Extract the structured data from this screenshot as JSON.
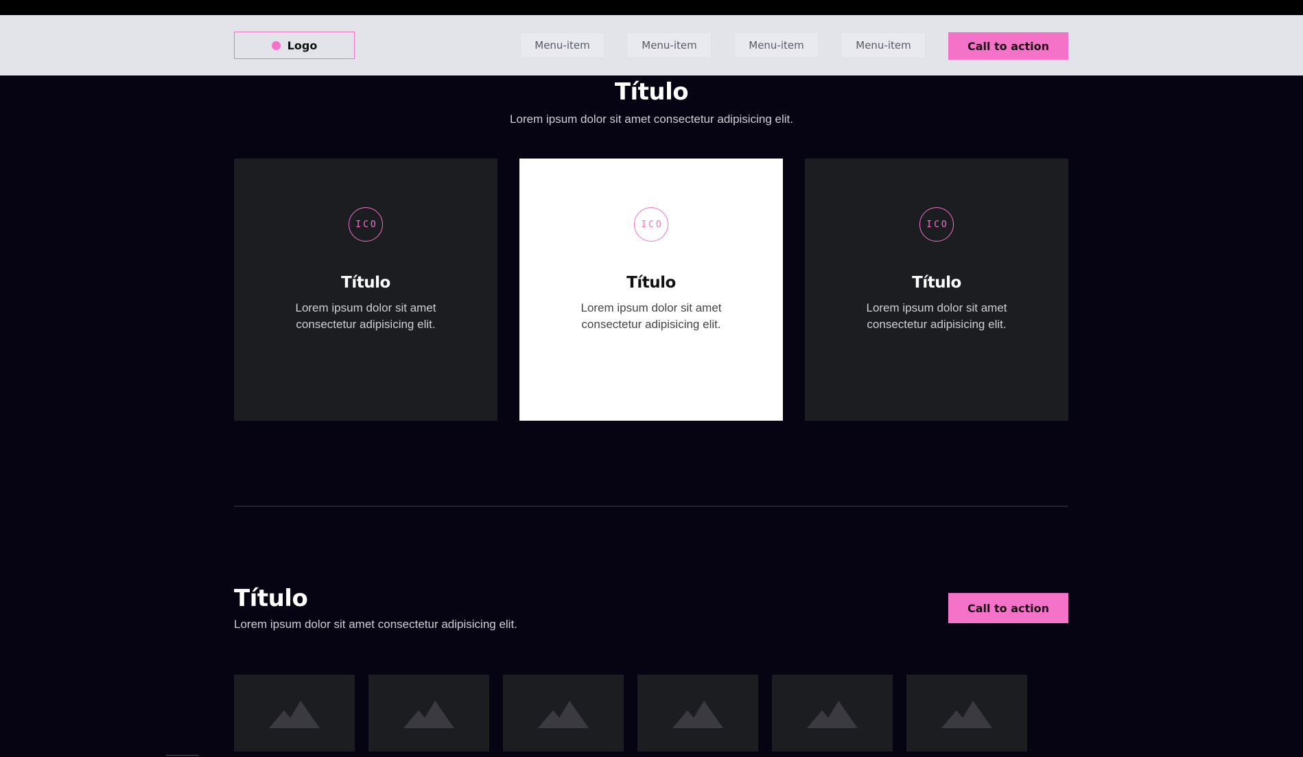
{
  "header": {
    "logo_label": "Logo",
    "menu": [
      "Menu-item",
      "Menu-item",
      "Menu-item",
      "Menu-item"
    ],
    "cta_label": "Call to action"
  },
  "features": {
    "title": "Título",
    "subtitle": "Lorem ipsum dolor sit amet consectetur adipisicing elit.",
    "cards": [
      {
        "icon_text": "ICO",
        "title": "Título",
        "text": "Lorem ipsum dolor sit amet consectetur adipisicing elit."
      },
      {
        "icon_text": "ICO",
        "title": "Título",
        "text": "Lorem ipsum dolor sit amet consectetur adipisicing elit."
      },
      {
        "icon_text": "ICO",
        "title": "Título",
        "text": "Lorem ipsum dolor sit amet consectetur adipisicing elit."
      }
    ]
  },
  "gallery": {
    "title": "Título",
    "subtitle": "Lorem ipsum dolor sit amet consectetur adipisicing elit.",
    "cta_label": "Call to action",
    "thumbnails": [
      "image-placeholder-icon",
      "image-placeholder-icon",
      "image-placeholder-icon",
      "image-placeholder-icon",
      "image-placeholder-icon",
      "image-placeholder-icon"
    ]
  },
  "colors": {
    "accent": "#f472c8",
    "background": "#060312",
    "header_bg": "#e2e4ea",
    "card_dark": "#1c1d20",
    "card_light": "#ffffff"
  }
}
